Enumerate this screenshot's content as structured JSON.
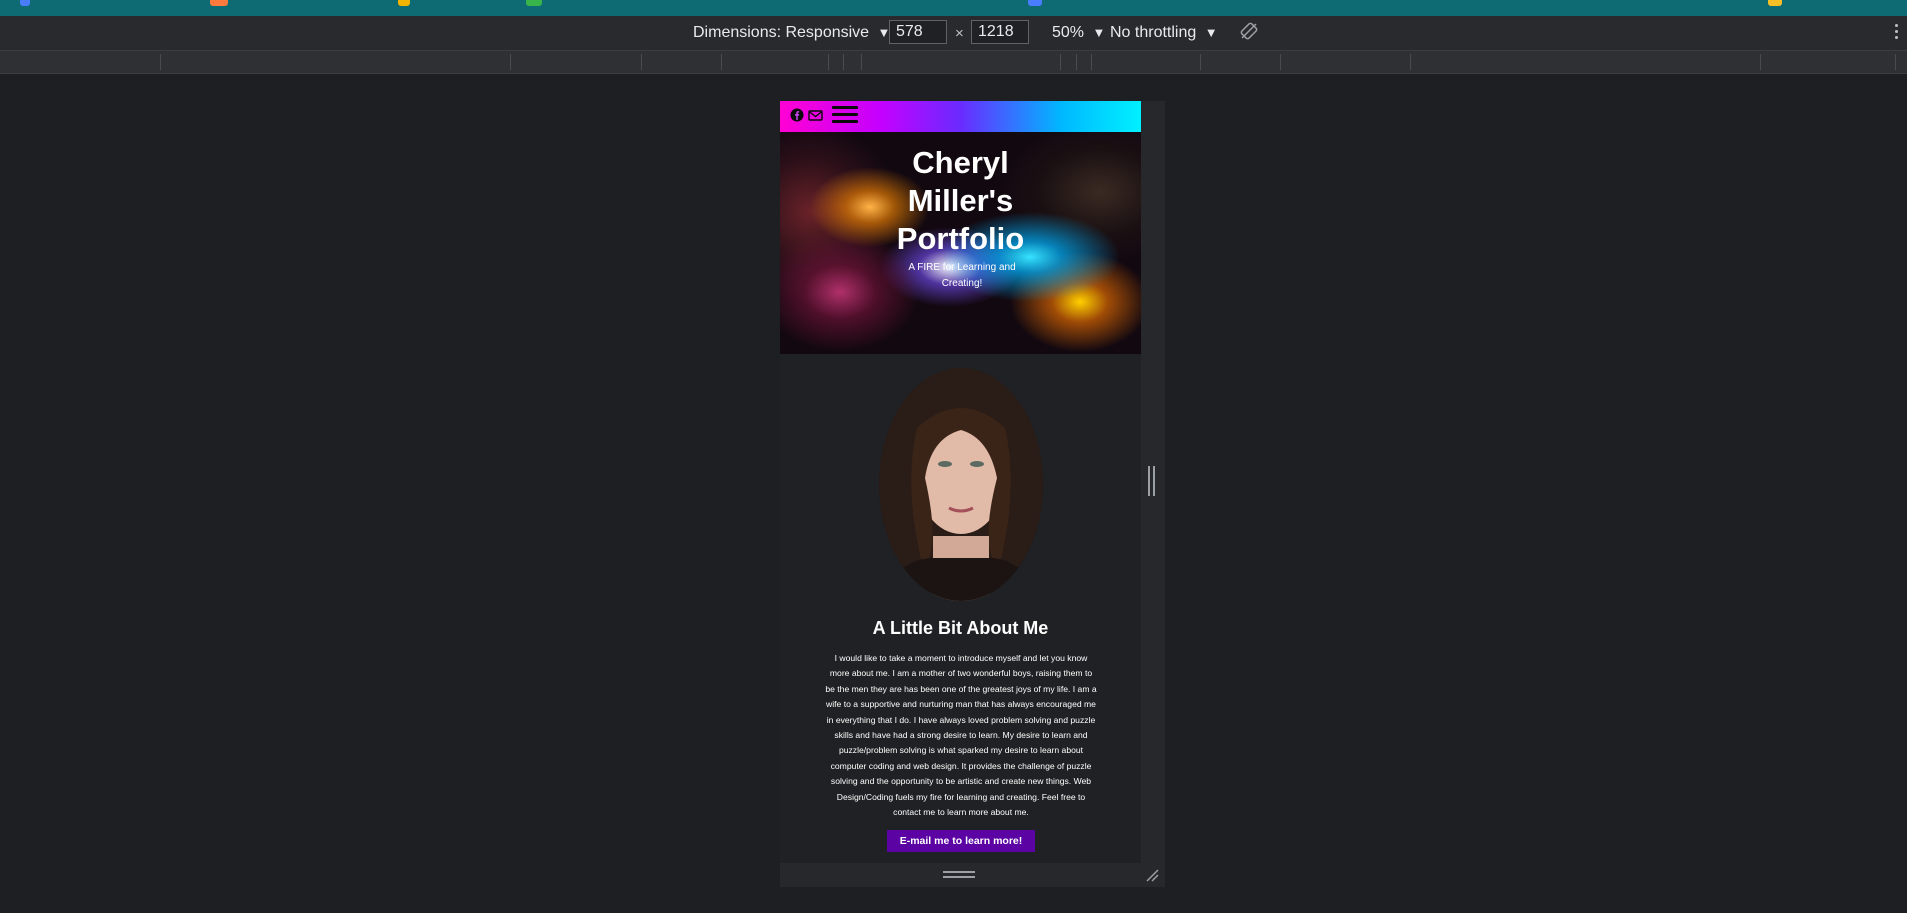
{
  "devtools": {
    "dimensions_label": "Dimensions: Responsive",
    "width_value": "578",
    "height_value": "1218",
    "times_symbol": "×",
    "zoom_label": "50%",
    "throttle_label": "No throttling",
    "dropdown_arrow": "▼"
  },
  "site": {
    "nav": {
      "icons": [
        "facebook-icon",
        "email-icon"
      ]
    },
    "hero": {
      "title": "Cheryl\nMiller's\nPortfolio",
      "subtitle": "A FIRE for Learning and Creating!"
    },
    "about": {
      "heading": "A Little Bit About Me",
      "text": "I would like to take a moment to introduce myself and let you know more about me. I am a mother of two wonderful boys, raising them to be the men they are has been one of the greatest joys of my life. I am a wife to a supportive and nurturing man that has always encouraged me in everything that I do. I have always loved problem solving and puzzle skills and have had a strong desire to learn. My desire to learn and puzzle/problem solving is what sparked my desire to learn about computer coding and web design. It provides the challenge of puzzle solving and the opportunity to be artistic and create new things. Web Design/Coding fuels my fire for learning and creating. Feel free to contact me to learn more about me.",
      "button_label": "E-mail me to learn more!"
    }
  },
  "colors": {
    "cta_background": "#5b04a3",
    "devtools_background": "#292a2d",
    "page_background": "#1e1f22"
  }
}
